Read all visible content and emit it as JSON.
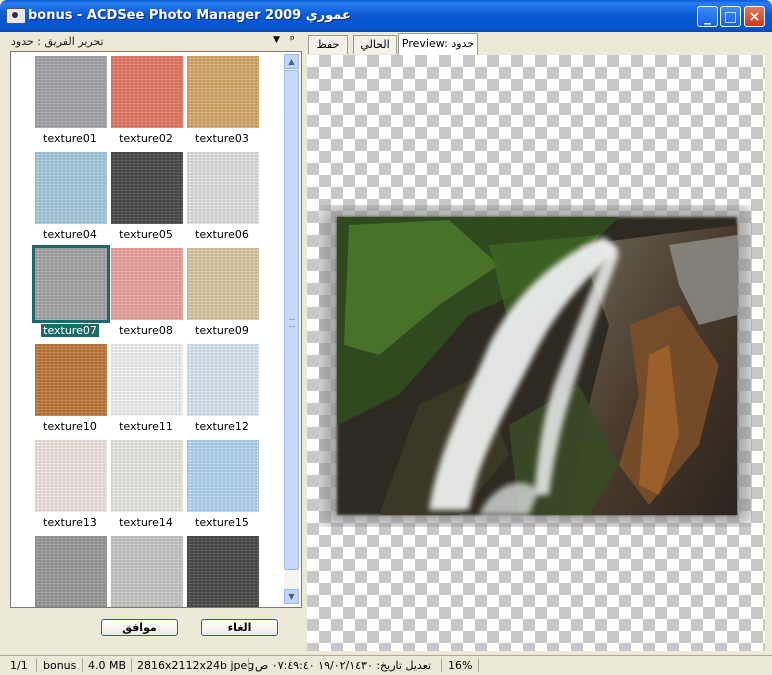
{
  "window": {
    "title": "bonus - ACDSee Photo Manager 2009 عموري",
    "min_label": "_",
    "max_label": "□",
    "close_label": "×"
  },
  "left_panel": {
    "header_label": "تحرير الفريق : حدود",
    "dropdown_glyph": "▼",
    "pin_glyph": "ᵖ",
    "textures": [
      {
        "name": "texture01",
        "color": "#a8a4ac"
      },
      {
        "name": "texture02",
        "color": "#e87864"
      },
      {
        "name": "texture03",
        "color": "#d9a96a"
      },
      {
        "name": "texture04",
        "color": "#a6cde0"
      },
      {
        "name": "texture05",
        "color": "#4a4a4a"
      },
      {
        "name": "texture06",
        "color": "#e2e2e2"
      },
      {
        "name": "texture07",
        "color": "#a7a7a7"
      },
      {
        "name": "texture08",
        "color": "#eea5a0"
      },
      {
        "name": "texture09",
        "color": "#dbc9a2"
      },
      {
        "name": "texture10",
        "color": "#c17a3a"
      },
      {
        "name": "texture11",
        "color": "#f4f4f4"
      },
      {
        "name": "texture12",
        "color": "#dbe9f3"
      },
      {
        "name": "texture13",
        "color": "#f1e6e2"
      },
      {
        "name": "texture14",
        "color": "#ebebe6"
      },
      {
        "name": "texture15",
        "color": "#b4d8f4"
      },
      {
        "name": "",
        "color": "#9a9a9a"
      },
      {
        "name": "",
        "color": "#c8c8c8"
      },
      {
        "name": "",
        "color": "#4a4a4a"
      }
    ],
    "selected_index": 6,
    "ok_button": "موافق",
    "cancel_button": "الغاء"
  },
  "tabs": {
    "save": "حفظ",
    "current": "الحالي",
    "preview": "Preview: حدود"
  },
  "status": {
    "page": "1/1",
    "folder": "bonus",
    "size": "4.0 MB",
    "dims": "2816x2112x24b jpeg",
    "modified": "تعديل تاريخ: ١٩/٠٢/١٤٣٠ ٠٧:٤٩:٤٠ ص",
    "zoom": "16%"
  }
}
